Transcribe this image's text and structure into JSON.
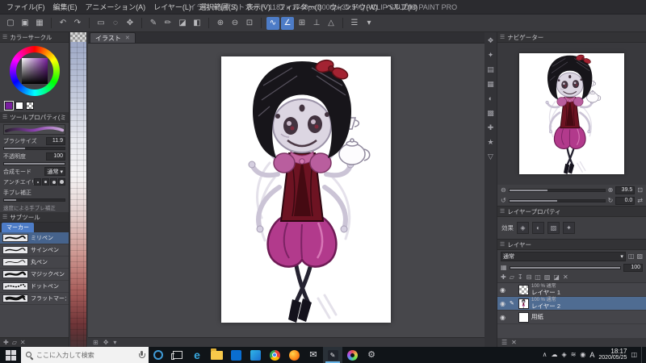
{
  "window": {
    "title": "イラスト*(ポストカード 1181 x 1748px 300dpi 39.5%) - CLIP STUDIO PAINT PRO"
  },
  "menubar": {
    "items": [
      "ファイル(F)",
      "編集(E)",
      "アニメーション(A)",
      "レイヤー(L)",
      "選択範囲(S)",
      "表示(V)",
      "フィルター(I)",
      "ウィンドウ(W)",
      "ヘルプ(H)"
    ]
  },
  "document": {
    "tab_label": "イラスト"
  },
  "color_panel": {
    "title": "カラーサークル"
  },
  "tool_property": {
    "title": "ツールプロパティ(ミリペン)",
    "brush_size_label": "ブラシサイズ",
    "brush_size_value": "11.9",
    "opacity_label": "不透明度",
    "opacity_value": "100",
    "blend_label": "合成モード",
    "blend_value": "通常",
    "antialias_label": "アンチエイリアス",
    "stabilize_label": "手ブレ補正",
    "footer_label": "速度による手ブレ補正"
  },
  "subtool_panel": {
    "title": "サブツール",
    "group_tab": "マーカー",
    "items": [
      "ミリペン",
      "サインペン",
      "丸ペン",
      "マジックペン",
      "ドットペン",
      "フラットマーカー"
    ]
  },
  "navigator": {
    "title": "ナビゲーター",
    "zoom_value": "39.5",
    "rotate_value": "0.0"
  },
  "layer_property": {
    "title": "レイヤープロパティ",
    "effect_label": "効果"
  },
  "layer_panel": {
    "tab_label": "レイヤー",
    "blend_value": "通常",
    "opacity_value": "100",
    "layers": [
      {
        "info": "100 % 通常",
        "name": "レイヤー 1"
      },
      {
        "info": "100 % 通常",
        "name": "レイヤー 2"
      },
      {
        "info": "",
        "name": "用紙"
      }
    ]
  },
  "taskbar": {
    "search_placeholder": "ここに入力して検索",
    "ime": "A",
    "time": "18:17",
    "date": "2020/05/25"
  },
  "icons": {
    "menu": "☰",
    "close": "✕",
    "chevron_down": "▾",
    "chevron_up": "∧",
    "new_file": "▢",
    "open_file": "▣",
    "save": "▦",
    "undo": "↶",
    "redo": "↷",
    "rect_select": "▭",
    "lasso": "◌",
    "move": "✥",
    "pen": "✎",
    "brush": "✏",
    "eraser": "◪",
    "fill": "◧",
    "zoom_in": "⊕",
    "zoom_out": "⊖",
    "fit_view": "⊡",
    "curve": "∿",
    "angle": "∠",
    "grid": "⊞",
    "snap": "⊥",
    "ruler": "△",
    "rotate_left": "↺",
    "rotate_right": "↻",
    "flip": "⇄",
    "eye": "◉",
    "pencil": "✎",
    "plus": "✚",
    "folder": "▱",
    "transfer": "↧",
    "merge": "⊟",
    "mask": "◫",
    "clip": "▨",
    "trash": "✕",
    "dock_1": "❖",
    "dock_2": "✦",
    "dock_3": "▤",
    "dock_4": "▦",
    "dock_5": "◐",
    "dock_6": "▩",
    "dock_7": "✚",
    "dock_8": "★",
    "dock_9": "▽",
    "effect_1": "◈",
    "effect_2": "◐",
    "effect_3": "▨",
    "effect_4": "✦",
    "cloud": "☁",
    "network": "≋",
    "volume": "◉",
    "security": "◈",
    "dots": "⋮"
  },
  "colors": {
    "accent_blue": "#4d7cc7",
    "selection_blue": "#4f6c92",
    "canvas_bg": "#47474b",
    "taskbar_black": "#101418",
    "main_color": "#7a1fa0",
    "hair_black": "#17151a",
    "bow_red": "#a32332",
    "skin_lavender": "#dcd6e2",
    "blouse_maroon": "#6d1322",
    "puff_pink": "#b95e9e",
    "shorts_magenta": "#b23a8c"
  }
}
